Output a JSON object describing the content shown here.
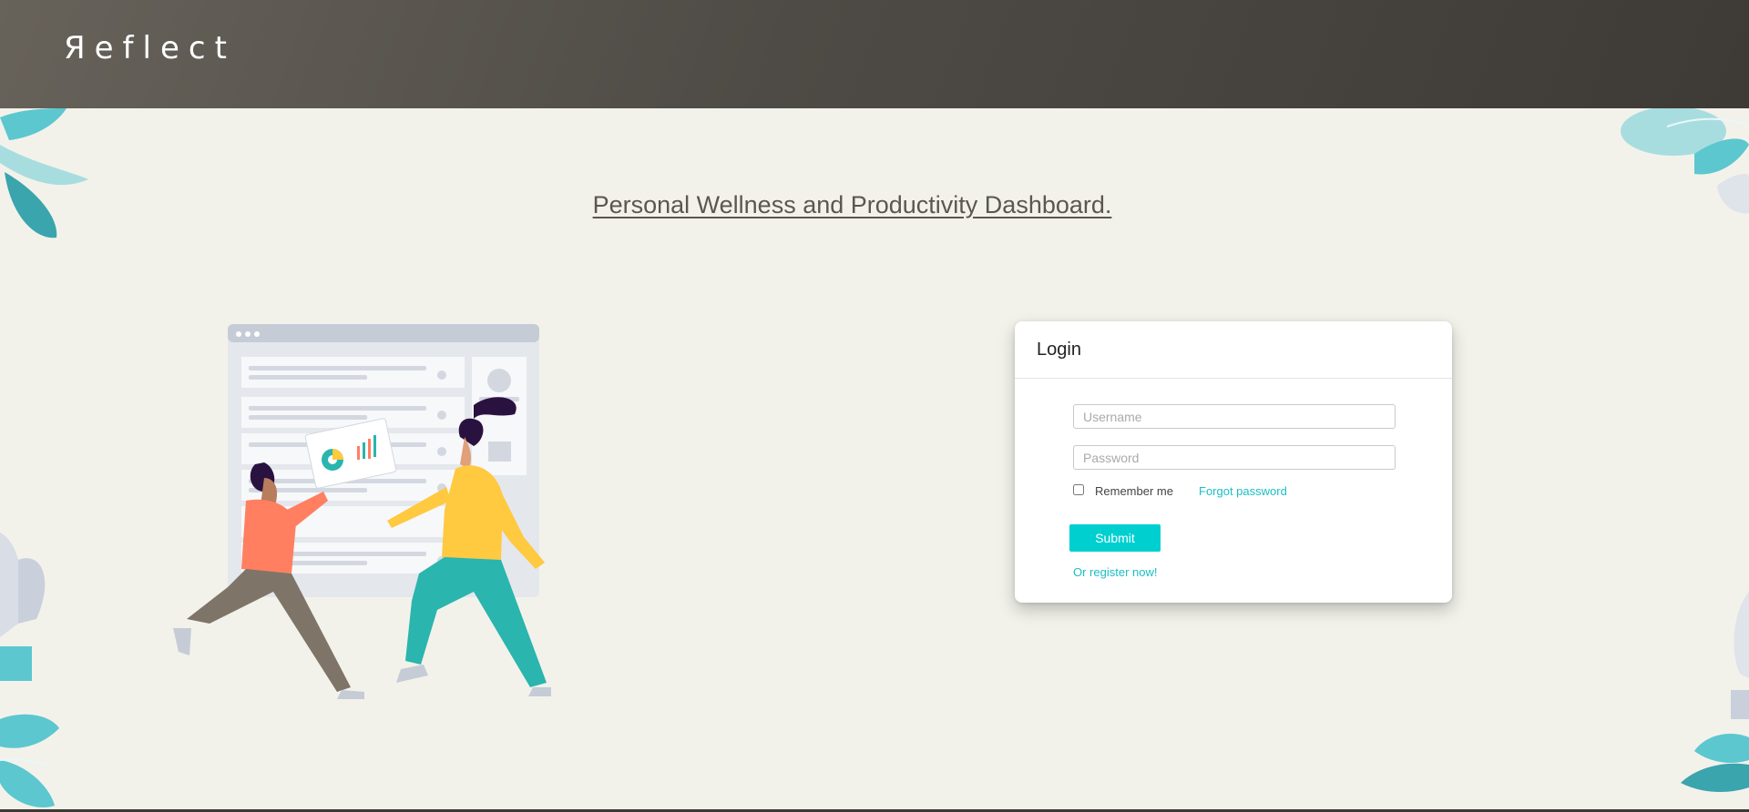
{
  "header": {
    "logo_text": "Яeflect"
  },
  "main": {
    "headline": "Personal Wellness and Productivity Dashboard."
  },
  "login": {
    "title": "Login",
    "username_placeholder": "Username",
    "password_placeholder": "Password",
    "remember_label": "Remember me",
    "forgot_label": "Forgot password",
    "submit_label": "Submit",
    "register_label": "Or register now!"
  },
  "colors": {
    "header_dark": "#3e3a36",
    "page_background": "#f2f2eb",
    "accent": "#00cfd0",
    "link": "#1bbfc4"
  },
  "icons": [
    "leaf-decoration-icon",
    "checkbox-icon"
  ]
}
